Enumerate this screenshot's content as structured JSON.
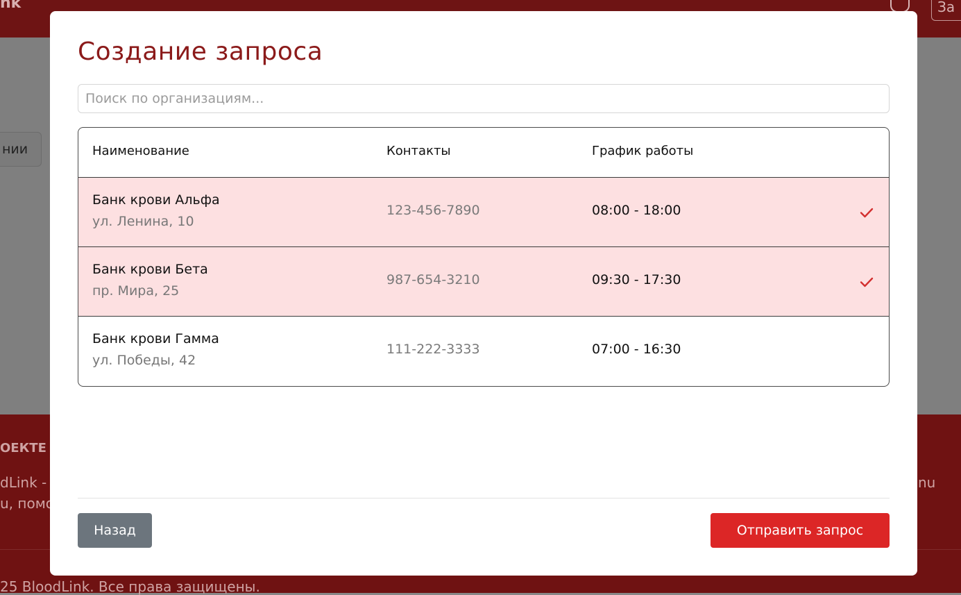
{
  "background": {
    "logo_fragment": "nk",
    "chip_fragment": "нии",
    "footer_heading_fragment": "ОЕКТЕ",
    "footer_line1_fragment": "dLink - c",
    "footer_line2_fragment": "u, помо",
    "footer_right_fragment": "nu",
    "copyright_fragment": "25 BloodLink. Все права защищены."
  },
  "modal": {
    "title": "Создание запроса",
    "search": {
      "placeholder": "Поиск по организациям..."
    },
    "table": {
      "headers": [
        "Наименование",
        "Контакты",
        "График работы"
      ],
      "rows": [
        {
          "name": "Банк крови Альфа",
          "address": "ул. Ленина, 10",
          "phone": "123-456-7890",
          "hours": "08:00 - 18:00",
          "selected": true
        },
        {
          "name": "Банк крови Бета",
          "address": "пр. Мира, 25",
          "phone": "987-654-3210",
          "hours": "09:30 - 17:30",
          "selected": true
        },
        {
          "name": "Банк крови Гамма",
          "address": "ул. Победы, 42",
          "phone": "111-222-3333",
          "hours": "07:00 - 16:30",
          "selected": false
        }
      ]
    },
    "buttons": {
      "back": "Назад",
      "send": "Отправить запрос"
    }
  },
  "colors": {
    "brand": "#8b1a1a",
    "selected_row": "#fde0e1",
    "primary_button": "#dc2626",
    "secondary_button": "#6c757d",
    "check": "#d32f2f"
  },
  "icons": {
    "notification": "bell-icon",
    "selected": "check-icon"
  }
}
